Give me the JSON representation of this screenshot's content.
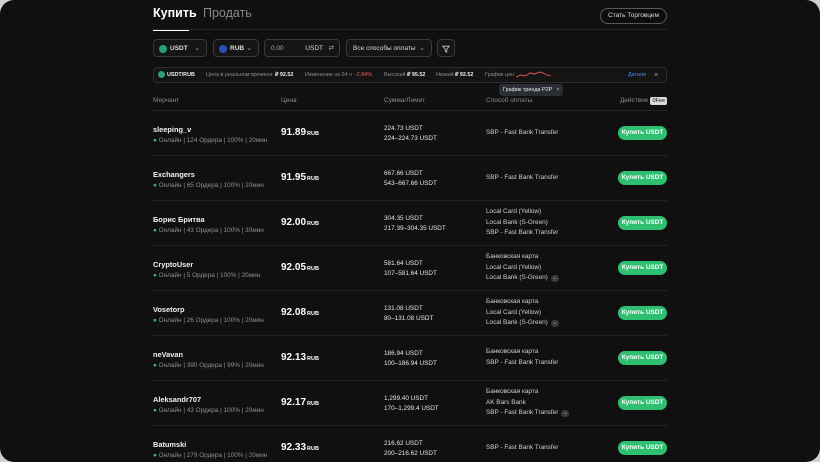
{
  "tabs": {
    "buy": "Купить",
    "sell": "Продать"
  },
  "become_merchant": "Стать Торговцем",
  "filters": {
    "coin": "USDT",
    "fiat": "RUB",
    "amount_value": "0.00",
    "amount_currency": "USDT",
    "payment": "Все способы оплаты"
  },
  "ticker": {
    "pair": "USDT/RUB",
    "realtime_label": "Цена в реальном времени",
    "realtime_value": "₽ 92.52",
    "change_label": "Изменение за 24 ч",
    "change_value": "-2.84%",
    "high_label": "Высокий",
    "high_value": "₽ 95.52",
    "low_label": "Низкий",
    "low_value": "₽ 92.52",
    "chart_label": "График цен",
    "details": "Детали"
  },
  "tooltip": "График тренда P2P",
  "columns": {
    "merchant": "Мерчант",
    "price": "Цена",
    "amount": "Сумма/Лимит",
    "payment": "Способ оплаты",
    "action": "Действие",
    "fee": "0Fee"
  },
  "buy_label": "Купить USDT",
  "rows": [
    {
      "name": "sleeping_v",
      "stats": "Онлайн | 124 Ордера | 100% | 20мин",
      "price": "91.89",
      "cur": "RUB",
      "amount": "224.73 USDT",
      "limit": "224–224.73 USDT",
      "pay": [
        "SBP - Fast Bank Transfer"
      ]
    },
    {
      "name": "Exchangers",
      "stats": "Онлайн | 65 Ордера | 100% | 20мин",
      "price": "91.95",
      "cur": "RUB",
      "amount": "667.66 USDT",
      "limit": "543–667.66 USDT",
      "pay": [
        "SBP - Fast Bank Transfer"
      ]
    },
    {
      "name": "Борис Бритва",
      "stats": "Онлайн | 43 Ордера | 100% | 30мин",
      "price": "92.00",
      "cur": "RUB",
      "amount": "304.35 USDT",
      "limit": "217.39–304.35 USDT",
      "pay": [
        "Local Card (Yellow)",
        "Local Bank (S-Green)",
        "SBP - Fast Bank Transfer"
      ]
    },
    {
      "name": "CryptoUser",
      "stats": "Онлайн | 5 Ордера | 100% | 20мин",
      "price": "92.05",
      "cur": "RUB",
      "amount": "581.64 USDT",
      "limit": "107–581.64 USDT",
      "pay": [
        "Банковская карта",
        "Local Card (Yellow)",
        "Local Bank (S-Green)"
      ]
    },
    {
      "name": "Vosetorp",
      "stats": "Онлайн | 26 Ордера | 100% | 20мин",
      "price": "92.08",
      "cur": "RUB",
      "amount": "131.08 USDT",
      "limit": "80–131.08 USDT",
      "pay": [
        "Банковская карта",
        "Local Card (Yellow)",
        "Local Bank (S-Green)"
      ]
    },
    {
      "name": "neVavan",
      "stats": "Онлайн | 390 Ордера | 99% | 20мин",
      "price": "92.13",
      "cur": "RUB",
      "amount": "186.94 USDT",
      "limit": "100–186.94 USDT",
      "pay": [
        "Банковская карта",
        "SBP - Fast Bank Transfer"
      ]
    },
    {
      "name": "Aleksandr707",
      "stats": "Онлайн | 43 Ордера | 100% | 20мин",
      "price": "92.17",
      "cur": "RUB",
      "amount": "1,299.40 USDT",
      "limit": "170–1,299.4 USDT",
      "pay": [
        "Банковская карта",
        "AK Bars Bank",
        "SBP - Fast Bank Transfer"
      ]
    },
    {
      "name": "Batumski",
      "stats": "Онлайн | 279 Ордера | 100% | 20мин",
      "price": "92.33",
      "cur": "RUB",
      "amount": "216.62 USDT",
      "limit": "200–216.62 USDT",
      "pay": [
        "SBP - Fast Bank Transfer"
      ]
    }
  ],
  "colors": {
    "accent": "#2fbf71",
    "negative": "#ef5a5a",
    "link": "#4a8cf5"
  }
}
